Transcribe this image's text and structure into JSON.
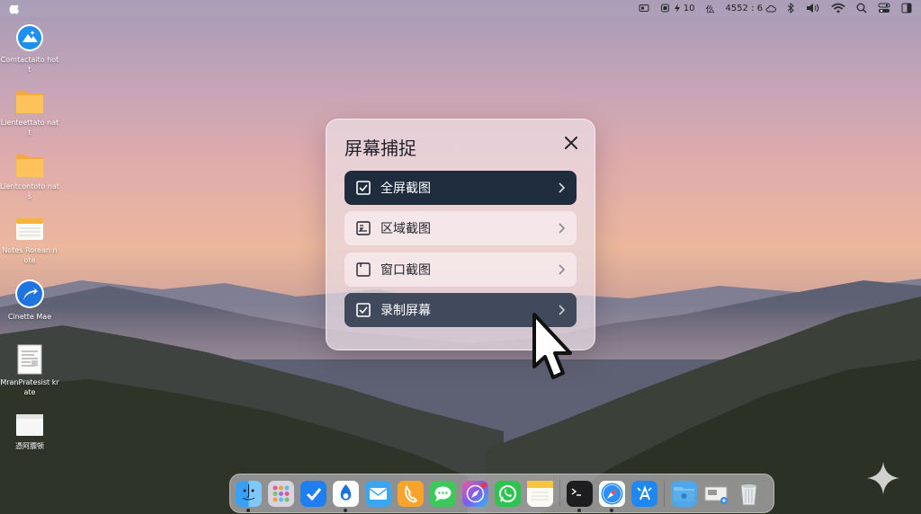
{
  "menubar": {
    "battery_value": "10",
    "keyboard_label": "仫",
    "clock": "4552 : 6"
  },
  "desktop_icons": [
    {
      "label": "Comtactaito hott",
      "icon": "app-blue-icon"
    },
    {
      "label": "Lienteettato natt",
      "icon": "folder-icon"
    },
    {
      "label": "Lientcontoto nats",
      "icon": "folder-icon"
    },
    {
      "label": "Notes Rorean note",
      "icon": "notes-icon"
    },
    {
      "label": "Cinette Mae",
      "icon": "app-arrow-icon"
    },
    {
      "label": "MranPratesist krate",
      "icon": "document-icon"
    },
    {
      "label": "憑阿膘顿",
      "icon": "folder-white-icon"
    }
  ],
  "panel": {
    "title": "屏幕捕捉",
    "options": [
      {
        "label": "全屏截图",
        "icon": "checkbox-icon"
      },
      {
        "label": "区域截图",
        "icon": "region-select-icon"
      },
      {
        "label": "窗口截图",
        "icon": "window-icon"
      },
      {
        "label": "录制屏幕",
        "icon": "checkbox-icon"
      }
    ]
  },
  "dock": {
    "apps": [
      "finder-icon",
      "launchpad-icon",
      "tasks-icon",
      "app-store-drop-icon",
      "mail-icon",
      "phone-icon",
      "messages-icon",
      "safari-compass-icon",
      "whatsapp-icon",
      "notes-icon",
      "terminal-icon",
      "safari-icon",
      "app-store-icon",
      "folder-icon",
      "preview-icon",
      "trash-icon"
    ]
  },
  "colors": {
    "selected": "#1f2c3d",
    "hover": "#404a5c",
    "panel": "#ebdee4"
  }
}
